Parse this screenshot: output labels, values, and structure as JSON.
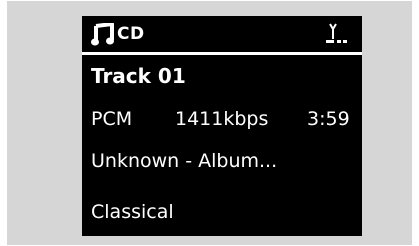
{
  "header": {
    "source_label": "CD",
    "source_icon": "music-note-icon",
    "signal_icon": "antenna-icon"
  },
  "track": {
    "title": "Track 01",
    "format": "PCM",
    "bitrate": "1411kbps",
    "duration": "3:59",
    "artist_album": "Unknown - Album...",
    "genre": "Classical"
  },
  "colors": {
    "screen_background": "#000000",
    "screen_text": "#ffffff",
    "frame_background": "#d6d6d6"
  }
}
